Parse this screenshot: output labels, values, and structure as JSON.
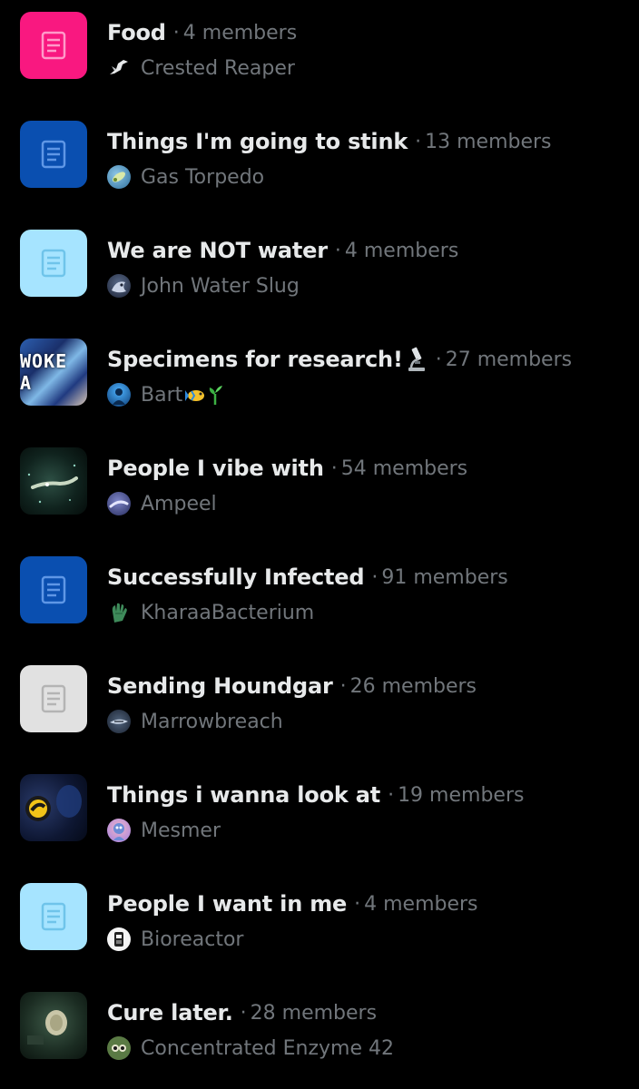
{
  "members_word": "members",
  "separator": "·",
  "lists": [
    {
      "name": "Food",
      "members": "4 members",
      "owner": "Crested Reaper",
      "thumb_color": "#f91880",
      "thumb_icon": "list-icon"
    },
    {
      "name": "Things I'm going to stink",
      "members": "13 members",
      "owner": "Gas Torpedo",
      "thumb_color": "#0a4fb0",
      "thumb_icon": "list-icon"
    },
    {
      "name": "We are NOT water",
      "members": "4 members",
      "owner": "John Water Slug",
      "thumb_color": "#a6e4ff",
      "thumb_icon": "list-icon"
    },
    {
      "name": "Specimens for research!",
      "name_emoji": "microscope-emoji",
      "members": "27 members",
      "owner": "Bart",
      "owner_emoji": "fish-sprout-emoji",
      "thumb_text": "WOKE A",
      "thumb_icon": "image"
    },
    {
      "name": "People I vibe with",
      "members": "54 members",
      "owner": "Ampeel",
      "thumb_icon": "image"
    },
    {
      "name": "Successfully Infected",
      "members": "91 members",
      "owner": "KharaaBacterium",
      "thumb_color": "#0a4fb0",
      "thumb_icon": "list-icon"
    },
    {
      "name": "Sending Houndgar",
      "members": "26 members",
      "owner": "Marrowbreach",
      "thumb_color": "#e1e1e1",
      "thumb_icon": "list-icon"
    },
    {
      "name": "Things i wanna look at",
      "members": "19 members",
      "owner": "Mesmer",
      "thumb_icon": "image"
    },
    {
      "name": "People I want in me",
      "members": "4 members",
      "owner": "Bioreactor",
      "thumb_color": "#a6e4ff",
      "thumb_icon": "list-icon"
    },
    {
      "name": "Cure later.",
      "members": "28 members",
      "owner": "Concentrated Enzyme 42",
      "thumb_icon": "image"
    }
  ],
  "colors": {
    "background": "#000000",
    "primary_text": "#e7e9ea",
    "secondary_text": "#71767b",
    "pink": "#f91880",
    "blue": "#0a4fb0",
    "light_blue": "#a6e4ff",
    "light_gray": "#e1e1e1"
  }
}
